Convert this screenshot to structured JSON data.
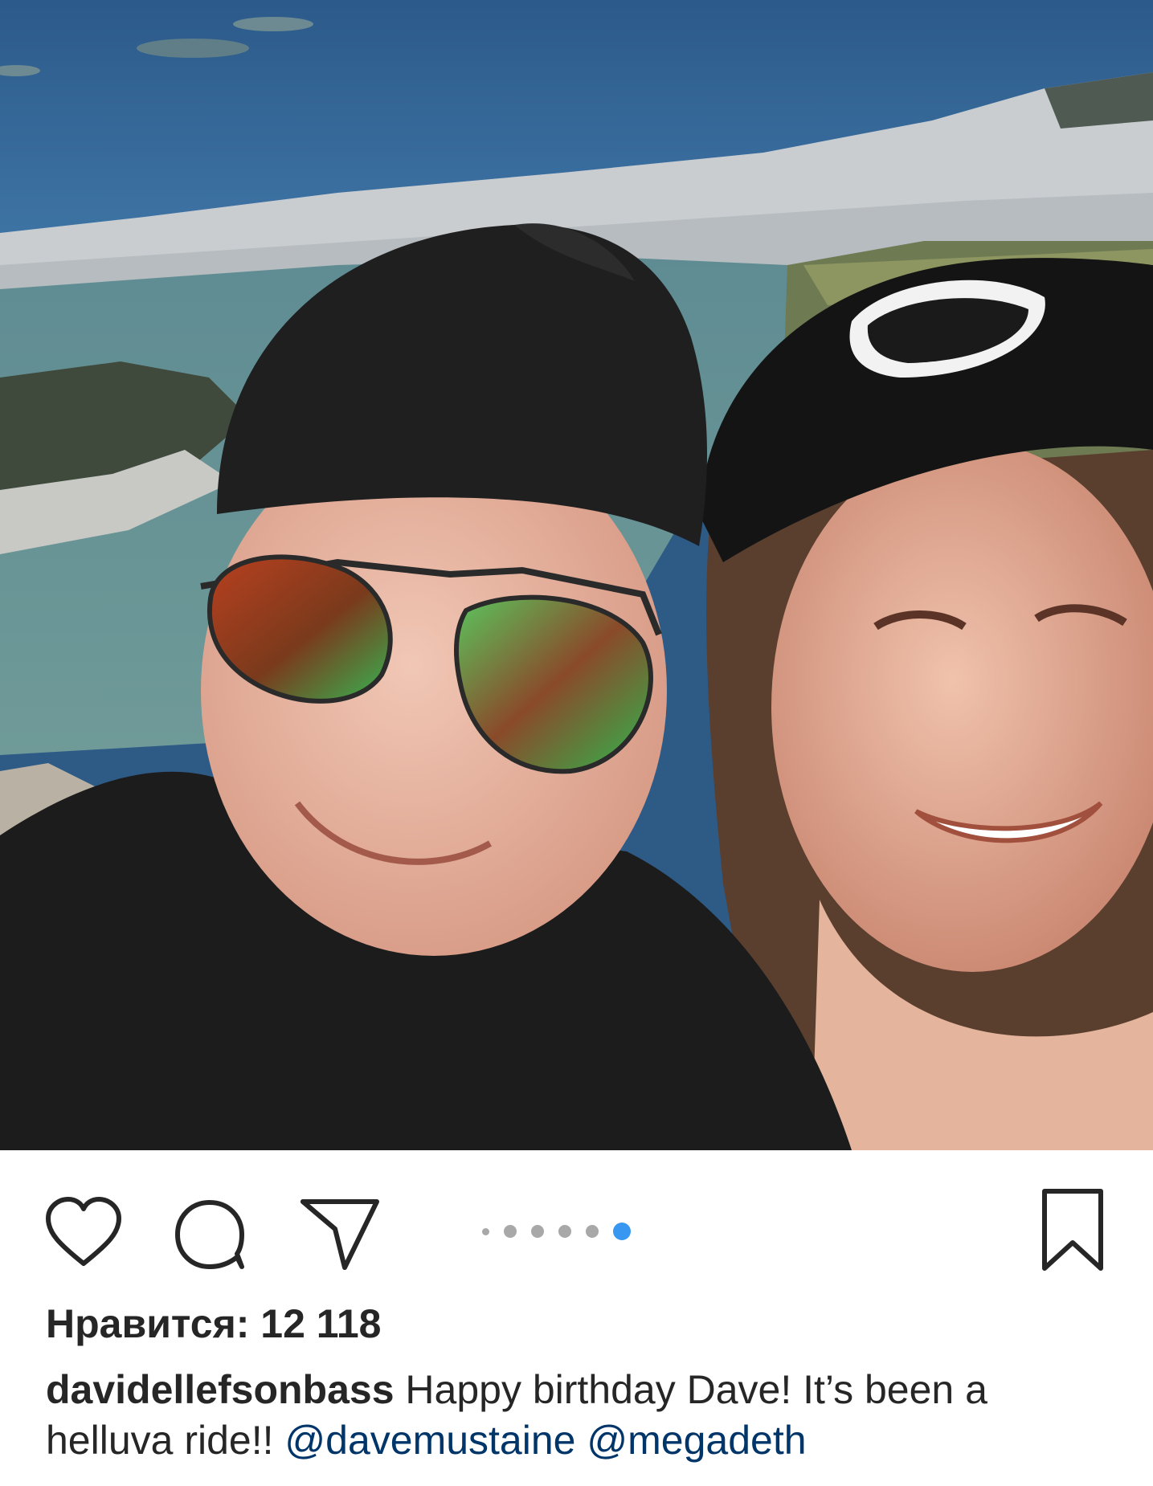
{
  "post": {
    "photo_alt": "selfie",
    "carousel": {
      "total": 6,
      "active_index": 5
    },
    "likes_text": "Нравится: 12 118",
    "caption": {
      "username": "davidellefsonbass",
      "text_part1": "Happy birthday Dave! It’s been a",
      "text_part2": "helluva ride!!",
      "mention1": "@davemustaine",
      "mention2": "@megadeth"
    }
  },
  "icons": {
    "like": "heart-outline-icon",
    "comment": "speech-bubble-icon",
    "share": "paper-plane-icon",
    "save": "bookmark-outline-icon"
  },
  "colors": {
    "text": "#262626",
    "mention": "#003569",
    "dot_active": "#3897f0",
    "dot_inactive": "#a8a8a8"
  }
}
